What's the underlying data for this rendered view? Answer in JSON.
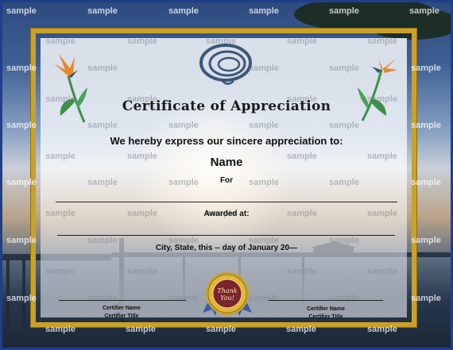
{
  "certificate": {
    "title": "Certificate of Appreciation",
    "intro": "We hereby express our sincere appreciation to:",
    "name": "Name",
    "for_label": "For",
    "awarded_at": "Awarded at:",
    "location_date": "City, State, this -- day of January 20—",
    "seal_text_line1": "Thank",
    "seal_text_line2": "You!",
    "certifier_left": {
      "name": "Certifier Name",
      "title": "Certifier Title"
    },
    "certifier_right": {
      "name": "Certifier Name",
      "title": "Certifier Title"
    }
  },
  "watermark": {
    "text": "sample"
  },
  "colors": {
    "frame_gold": "#c9a227",
    "page_border_blue": "#1f3f8a",
    "logo_blue": "#3b5778",
    "flower_orange": "#e8872a",
    "leaf_green": "#3e8f4a"
  }
}
